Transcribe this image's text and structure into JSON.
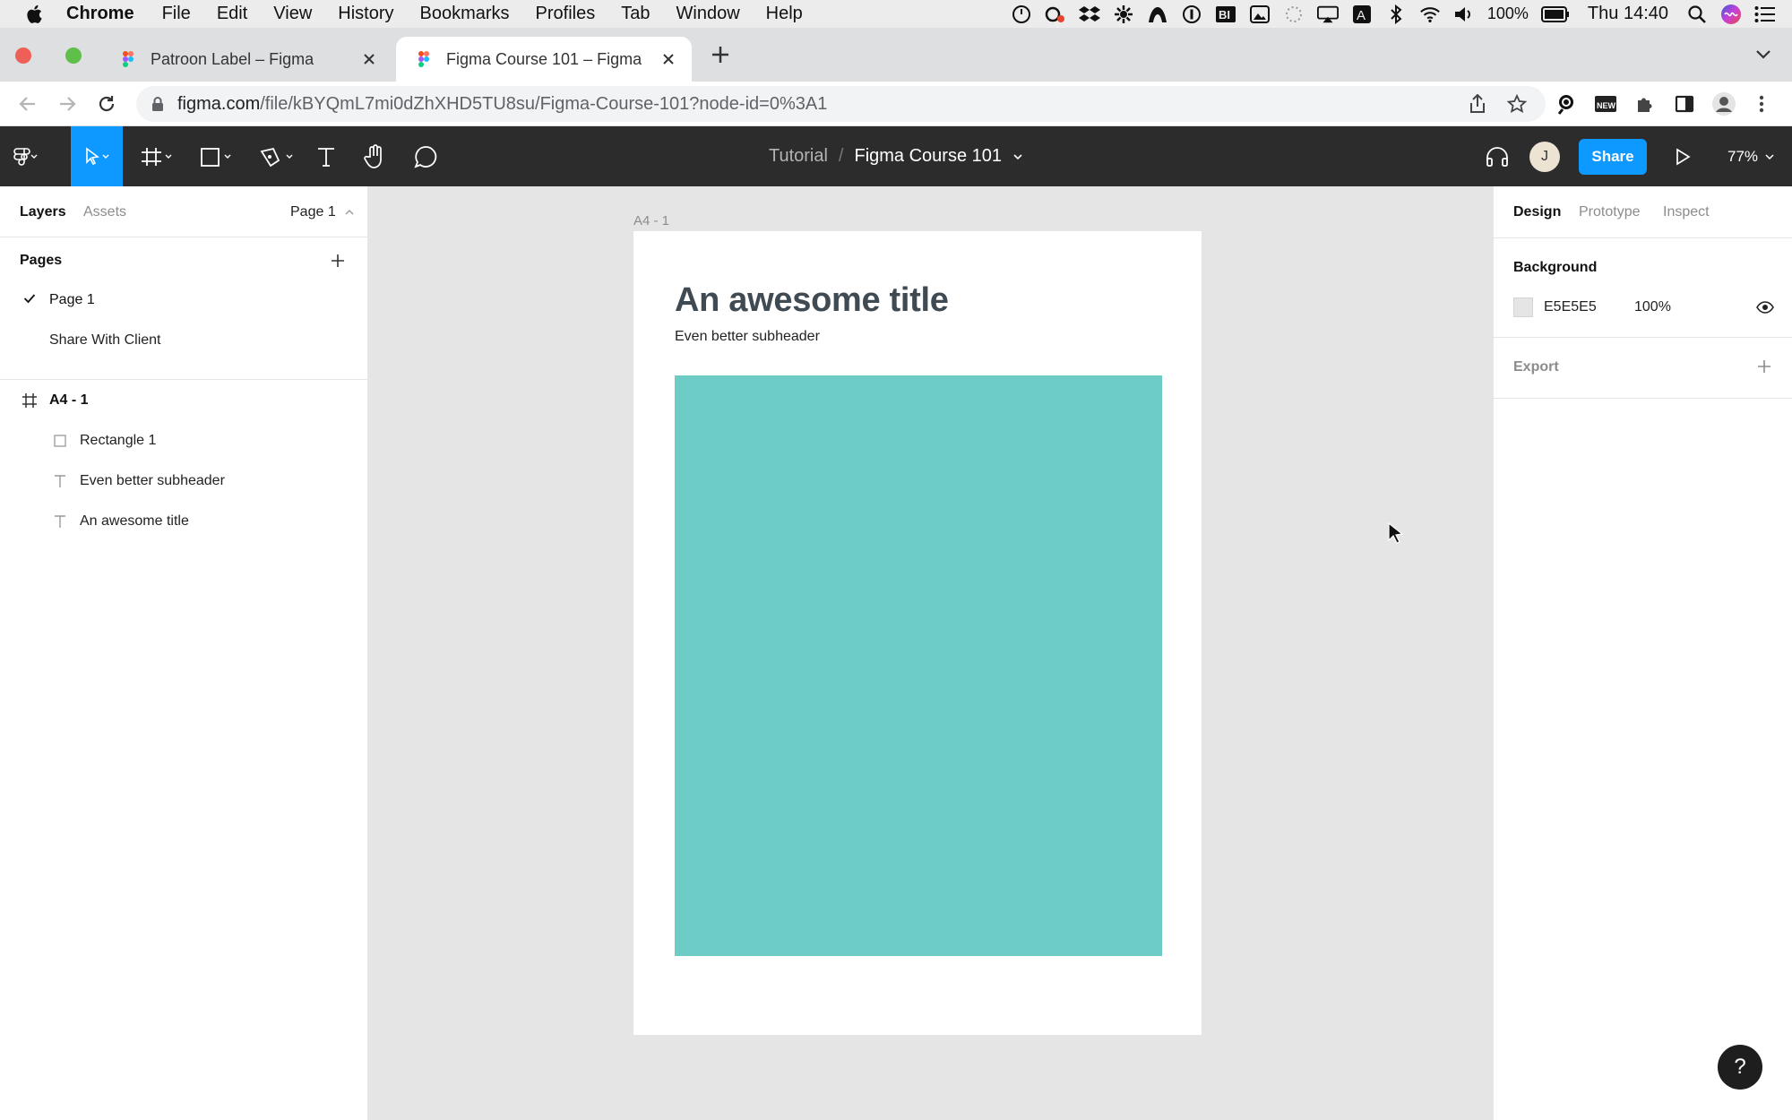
{
  "menubar": {
    "app": "Chrome",
    "items": [
      "File",
      "Edit",
      "View",
      "History",
      "Bookmarks",
      "Profiles",
      "Tab",
      "Window",
      "Help"
    ],
    "battery": "100%",
    "clock": "Thu 14:40"
  },
  "browser": {
    "tabs": [
      {
        "title": "Patroon Label – Figma",
        "active": false
      },
      {
        "title": "Figma Course 101 – Figma",
        "active": true
      }
    ],
    "url_host": "figma.com",
    "url_path": "/file/kBYQmL7mi0dZhXHD5TU8su/Figma-Course-101?node-id=0%3A1"
  },
  "figma_toolbar": {
    "project": "Tutorial",
    "separator": "/",
    "file_name": "Figma Course 101",
    "avatar_initial": "J",
    "share_label": "Share",
    "zoom": "77%"
  },
  "left_panel": {
    "tab_layers": "Layers",
    "tab_assets": "Assets",
    "page_selector": "Page 1",
    "pages_heading": "Pages",
    "pages": [
      {
        "name": "Page 1",
        "selected": true
      },
      {
        "name": "Share With Client",
        "selected": false
      }
    ],
    "layers": [
      {
        "name": "A4 - 1",
        "type": "frame"
      },
      {
        "name": "Rectangle 1",
        "type": "rectangle"
      },
      {
        "name": "Even better subheader",
        "type": "text"
      },
      {
        "name": "An awesome title",
        "type": "text"
      }
    ]
  },
  "right_panel": {
    "tabs": [
      "Design",
      "Prototype",
      "Inspect"
    ],
    "active_tab": "Design",
    "background_heading": "Background",
    "background_hex": "E5E5E5",
    "background_opacity": "100%",
    "export_heading": "Export"
  },
  "canvas": {
    "frame_label": "A4 - 1",
    "title": "An awesome title",
    "subheader": "Even better subheader",
    "rect_color": "#6dcdc6",
    "canvas_bg": "#e5e5e5"
  },
  "help_label": "?"
}
